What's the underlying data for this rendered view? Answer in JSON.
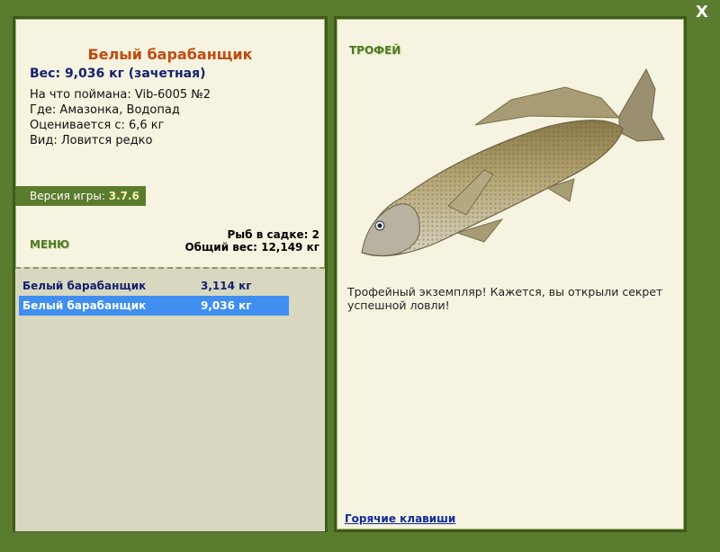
{
  "close_label": "X",
  "fish": {
    "title": "Белый барабанщик",
    "weight_line": "Вес: 9,036 кг (зачетная)",
    "caught_on": "На что поймана: Vib-6005 №2",
    "where": "Где: Амазонка, Водопад",
    "rated_from": "Оценивается с: 6,6 кг",
    "kind": "Вид: Ловится редко"
  },
  "version": {
    "label": "Версия игры:",
    "value": "3.7.6"
  },
  "menu_label": "МЕНЮ",
  "cage": {
    "count_line": "Рыб в садке: 2",
    "total_line": "Общий вес: 12,149 кг"
  },
  "catch_list": [
    {
      "name": "Белый барабанщик",
      "weight": "3,114 кг",
      "selected": false
    },
    {
      "name": "Белый барабанщик",
      "weight": "9,036 кг",
      "selected": true
    }
  ],
  "trophy": {
    "label": "ТРОФЕЙ",
    "text": "Трофейный экземпляр! Кажется, вы открыли секрет успешной ловли!"
  },
  "hotkeys_link": "Горячие клавиши",
  "colors": {
    "background": "#5a7c2e",
    "panel": "#f6f4e0",
    "title": "#c24a10",
    "selected_row": "#3f8ef0"
  }
}
